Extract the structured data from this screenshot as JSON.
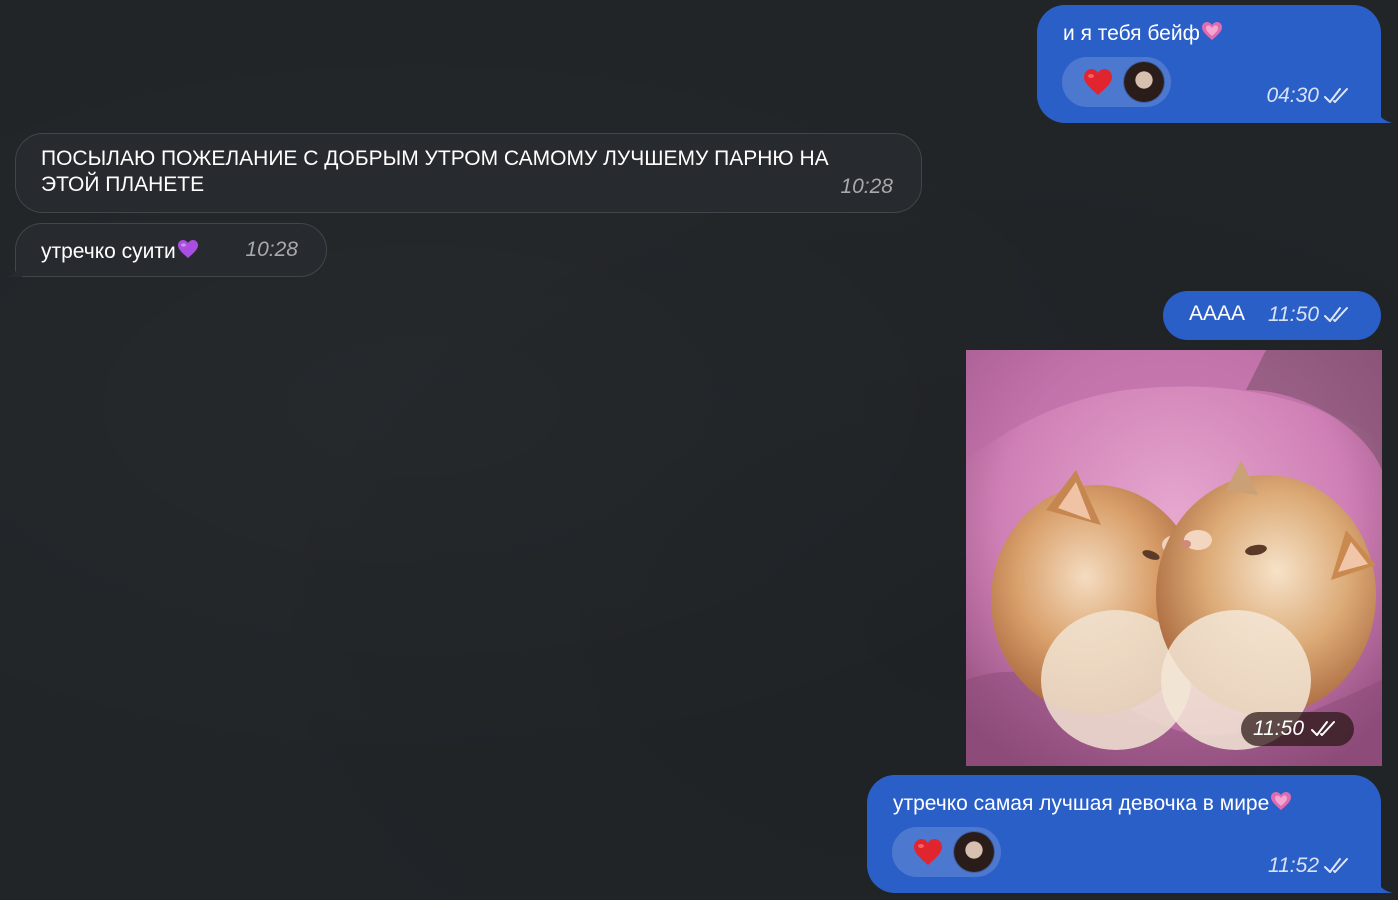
{
  "colors": {
    "background": "#212528",
    "outgoing_bubble": "#2b5fc8",
    "incoming_bubble": "#272a2e",
    "incoming_border": "#42464b",
    "heart_reaction": "#e0252e",
    "emoji_heart_pink": "#e06bb0",
    "emoji_heart_purple": "#a94ee0"
  },
  "messages": [
    {
      "direction": "outgoing",
      "text": "и я тебя бейф",
      "trailing_emoji": "pink-heart-icon",
      "time": "04:30",
      "status": "read",
      "reaction": {
        "emoji": "red-heart-icon",
        "reactor": "avatar"
      }
    },
    {
      "direction": "incoming",
      "text_line1": "ПОСЫЛАЮ ПОЖЕЛАНИЕ С ДОБРЫМ УТРОМ САМОМУ ЛУЧШЕМУ ПАРНЮ НА",
      "text_line2": "ЭТОЙ ПЛАНЕТЕ",
      "time": "10:28"
    },
    {
      "direction": "incoming",
      "text": "утречко суити",
      "trailing_emoji": "purple-heart-icon",
      "time": "10:28"
    },
    {
      "direction": "outgoing",
      "text": "АААА",
      "time": "11:50",
      "status": "read"
    },
    {
      "direction": "outgoing",
      "type": "video",
      "media_icon": "kittens-kissing-video",
      "time": "11:50",
      "status": "read"
    },
    {
      "direction": "outgoing",
      "text": "утречко самая лучшая девочка в мире",
      "trailing_emoji": "pink-heart-icon",
      "time": "11:52",
      "status": "read",
      "reaction": {
        "emoji": "red-heart-icon",
        "reactor": "avatar"
      }
    }
  ]
}
